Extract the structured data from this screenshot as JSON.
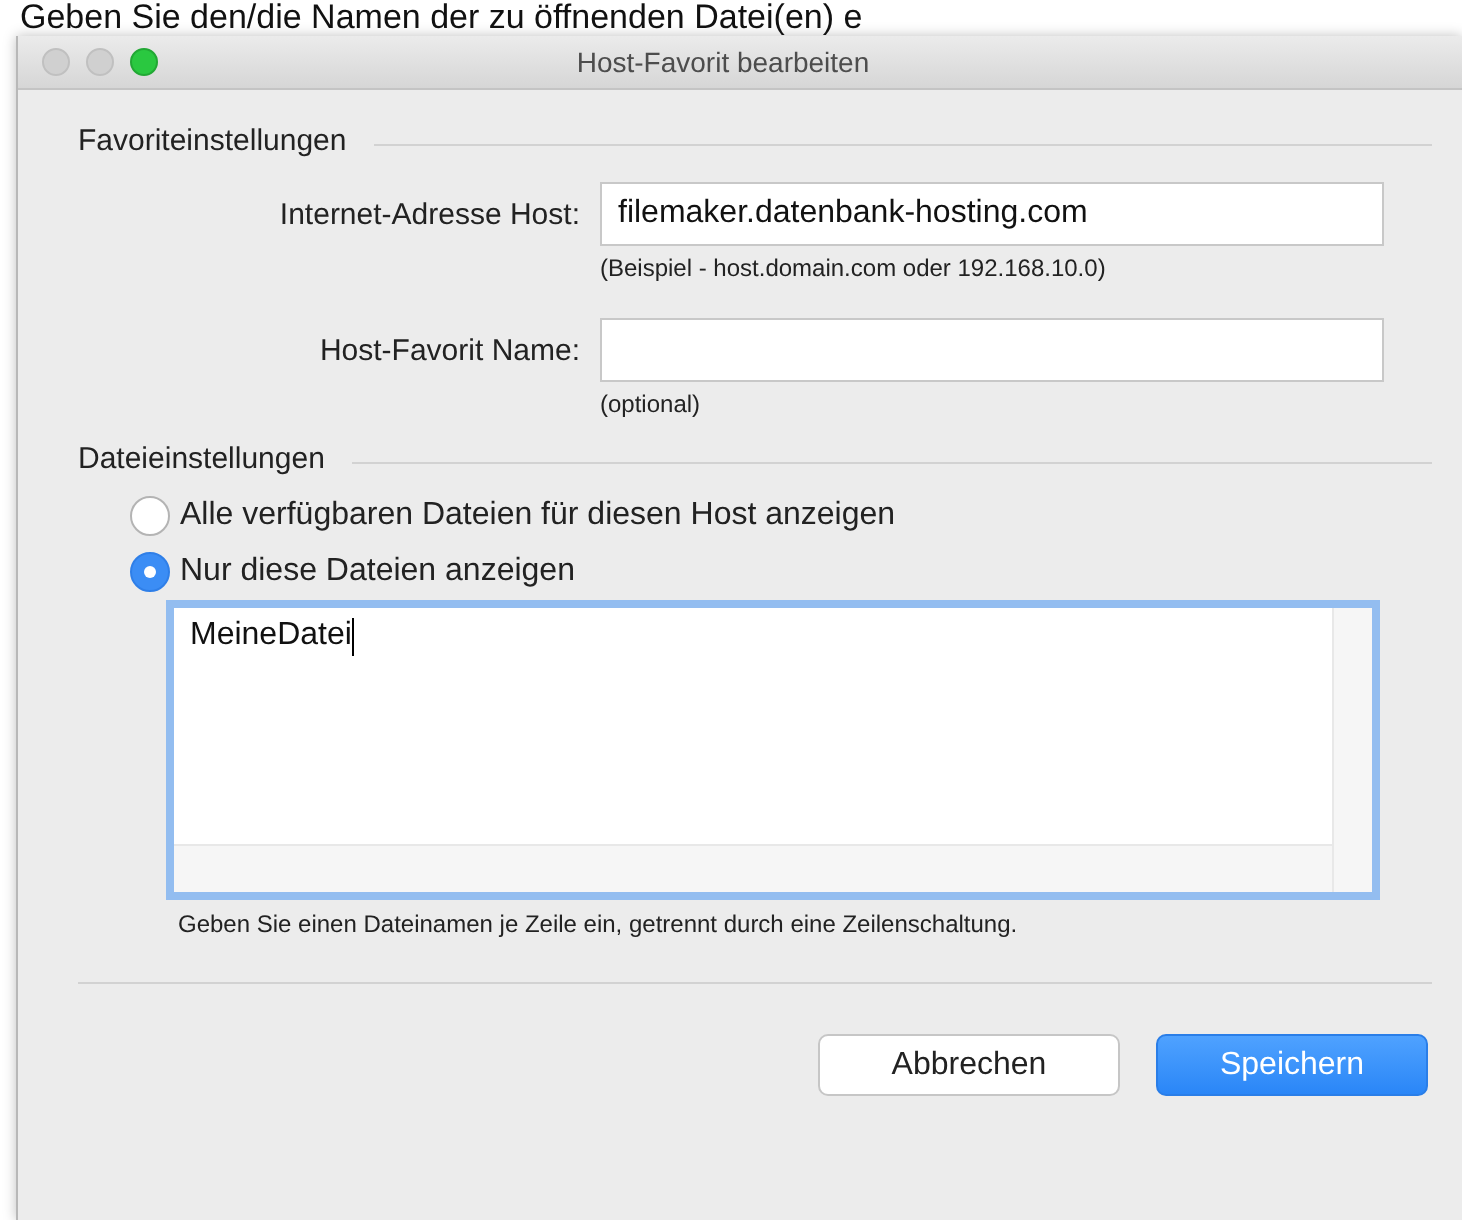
{
  "background_text": "Geben Sie den/die Namen der zu öffnenden Datei(en) e",
  "window": {
    "title": "Host-Favorit bearbeiten"
  },
  "favorite_settings": {
    "heading": "Favoriteinstellungen",
    "fields": [
      {
        "label": "Internet-Adresse Host:",
        "value": "filemaker.datenbank-hosting.com",
        "hint": "(Beispiel - host.domain.com oder 192.168.10.0)"
      },
      {
        "label": "Host-Favorit Name:",
        "hint": "(optional)"
      }
    ]
  },
  "file_settings": {
    "heading": "Dateieinstellungen",
    "options": [
      {
        "label": "Alle verfügbaren Dateien für diesen Host anzeigen",
        "selected": false
      },
      {
        "label": "Nur diese Dateien anzeigen",
        "selected": true
      }
    ],
    "file_list": {
      "value": "MeineDatei",
      "focused": true
    },
    "hint": "Geben Sie einen Dateinamen je Zeile ein, getrennt durch eine Zeilenschaltung."
  },
  "buttons": [
    {
      "label": "Abbrechen",
      "kind": "secondary"
    },
    {
      "label": "Speichern",
      "kind": "primary"
    }
  ]
}
